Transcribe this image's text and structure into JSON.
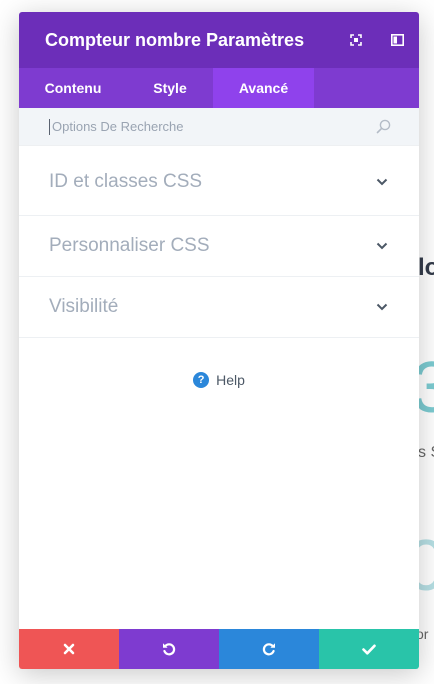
{
  "modal": {
    "title": "Compteur nombre Paramètres"
  },
  "tabs": [
    {
      "label": "Contenu"
    },
    {
      "label": "Style"
    },
    {
      "label": "Avancé",
      "active": true
    }
  ],
  "search": {
    "placeholder": "Options De Recherche",
    "value": ""
  },
  "toggles": [
    {
      "label": "ID et classes CSS"
    },
    {
      "label": "Personnaliser CSS"
    },
    {
      "label": "Visibilité"
    }
  ],
  "help": {
    "icon": "?",
    "label": "Help"
  },
  "background": {
    "title_fragment": "lo",
    "number_fragment": "3",
    "small_fragment": "s S",
    "number2_fragment": "0",
    "small2_fragment": "or"
  },
  "colors": {
    "header": "#6c2eb9",
    "tabs": "#7e3bd0",
    "active_tab": "#8f42ec",
    "cancel": "#ef5555",
    "undo": "#7e3bd0",
    "redo": "#2b87da",
    "save": "#29c4a9"
  },
  "icons": {
    "header": [
      "expand-icon",
      "sidebar-icon"
    ],
    "footer": [
      "close-icon",
      "undo-icon",
      "redo-icon",
      "check-icon"
    ]
  }
}
